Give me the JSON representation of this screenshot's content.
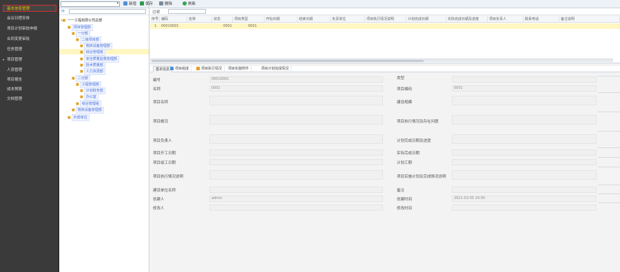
{
  "nav": {
    "items": [
      {
        "label": "基本信息管理",
        "active": true
      },
      {
        "label": "会议日程安排"
      },
      {
        "label": "项目计划审批申报"
      },
      {
        "label": "合同变更审批"
      },
      {
        "label": "任务管理"
      },
      {
        "label": "项目管理",
        "has_arrow": true
      },
      {
        "label": "人员管理"
      },
      {
        "label": "项目报告"
      },
      {
        "label": "成本预算"
      },
      {
        "label": "文档管理"
      }
    ]
  },
  "tree": {
    "root": "一一工程有限公司总部",
    "nodes": [
      {
        "label": "项目管理部",
        "level": 1
      },
      {
        "label": "一分部",
        "level": 2
      },
      {
        "label": "二级项目部",
        "level": 3
      },
      {
        "label": "综合管理组",
        "level": 4,
        "selected": true
      },
      {
        "label": "安全质量监督管理部",
        "level": 4
      },
      {
        "label": "技术质量部",
        "level": 4
      },
      {
        "label": "物资设备管理部",
        "level": 4
      },
      {
        "label": "二分部",
        "level": 2
      },
      {
        "label": "工程管理部",
        "level": 3
      },
      {
        "label": "计划财务部",
        "level": 3
      },
      {
        "label": "办公室",
        "level": 3
      },
      {
        "label": "人力资源部",
        "level": 3
      },
      {
        "label": "外部单位",
        "level": 1
      }
    ]
  },
  "toolbar": {
    "new": "新增",
    "save": "保存",
    "delete": "删除",
    "refresh": "刷新"
  },
  "filter": {
    "label": "过滤"
  },
  "grid": {
    "columns": [
      "序号",
      "编码",
      "名称",
      "状态",
      "项目类型",
      "开始日期",
      "结束日期",
      "负责单位",
      "项目执行情况说明",
      "计划完成日期",
      "实际完成日期及进度",
      "项目负责人",
      "联系电话",
      "备注说明"
    ],
    "rows": [
      {
        "cells": [
          "1",
          "00010001",
          "",
          "0001",
          "0001"
        ]
      }
    ]
  },
  "tabs": [
    "基本信息",
    "项目组成",
    "项目执行情况",
    "项目实施附件",
    "项目计划完成情况"
  ],
  "form": {
    "left": [
      {
        "label": "编号",
        "value": "00010001"
      },
      {
        "label": "名称",
        "value": "0001"
      },
      {
        "label": "项目名称",
        "value": ""
      },
      {
        "label": "项目概况",
        "value": ""
      },
      {
        "label": "项目负责人",
        "value": ""
      },
      {
        "label": "项目开工日期",
        "value": ""
      },
      {
        "label": "项目竣工日期",
        "value": ""
      },
      {
        "label": "项目执行情况说明",
        "value": ""
      },
      {
        "label": "建设单位名称",
        "value": ""
      },
      {
        "label": "创建人",
        "value": "admin"
      },
      {
        "label": "修改人",
        "value": ""
      }
    ],
    "right": [
      {
        "label": "类型",
        "value": ""
      },
      {
        "label": "项目编码",
        "value": "0001"
      },
      {
        "label": "建设规模",
        "value": ""
      },
      {
        "label": "项目执行情况及存在问题",
        "value": ""
      },
      {
        "label": "计划完成日期及进度",
        "value": ""
      },
      {
        "label": "实际完成日期",
        "value": ""
      },
      {
        "label": "计划工期",
        "value": ""
      },
      {
        "label": "项目实施计划及完成情况说明",
        "value": ""
      },
      {
        "label": "备注",
        "value": ""
      },
      {
        "label": "创建时间",
        "value": "2021-03-05 10:00"
      },
      {
        "label": "修改时间",
        "value": ""
      }
    ]
  },
  "colors": {
    "nav_bg": "#3a3a3a",
    "active_border": "#d63030",
    "selected_row": "#fff6c2",
    "tree_label": "#4a6fd8"
  }
}
